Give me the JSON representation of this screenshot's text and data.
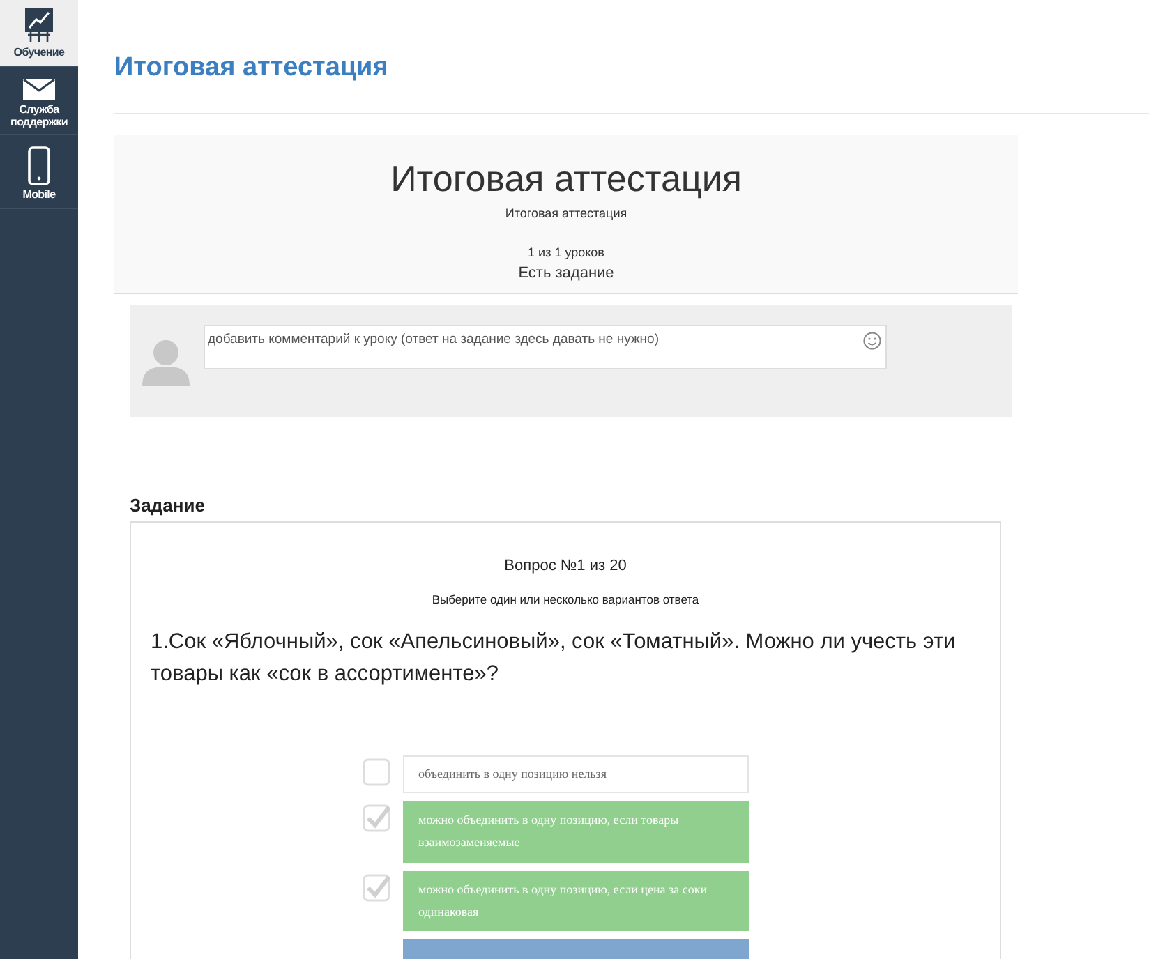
{
  "sidebar": {
    "items": [
      {
        "label": "Обучение",
        "kind": "chart",
        "selected": true
      },
      {
        "label": "Служба поддержки",
        "kind": "mail",
        "selected": false
      },
      {
        "label": "Mobile",
        "kind": "phone",
        "selected": false
      }
    ]
  },
  "page_title": "Итоговая аттестация",
  "lesson": {
    "title": "Итоговая аттестация",
    "subtitle": "Итоговая аттестация",
    "progress": "1 из 1 уроков",
    "note": "Есть задание"
  },
  "comment": {
    "placeholder": "добавить комментарий к уроку (ответ на задание здесь давать не нужно)"
  },
  "task": {
    "heading": "Задание",
    "counter": "Вопрос №1 из 20",
    "instruction": "Выберите один или несколько вариантов ответа",
    "question": "1.Сок «Яблочный», сок «Апельсиновый», сок «Томатный». Можно ли учесть эти товары как «сок в ассортименте»?",
    "options": [
      {
        "text": "объединить в одну позицию нельзя",
        "checked": false
      },
      {
        "text": "можно объединить в одну позицию, если товары взаимозаменяемые",
        "checked": true
      },
      {
        "text": "можно объединить в одну позицию, если цена за соки одинаковая",
        "checked": true
      }
    ]
  }
}
